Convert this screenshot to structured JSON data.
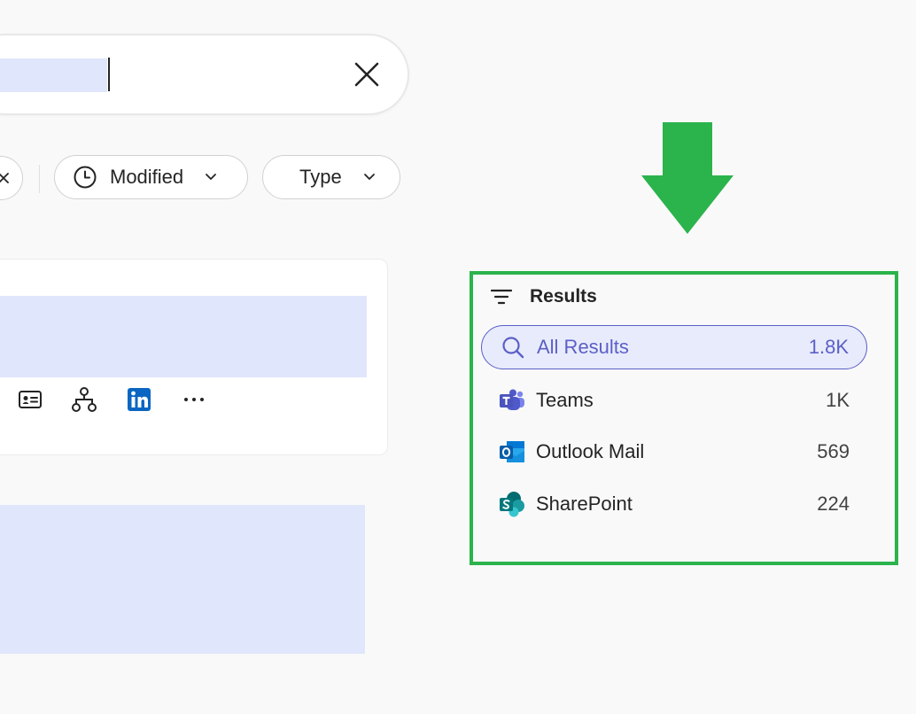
{
  "filters": {
    "modified_label": "Modified",
    "type_label": "Type"
  },
  "results": {
    "title": "Results",
    "items": [
      {
        "name": "All Results",
        "count": "1.8K",
        "icon": "search-icon",
        "active": true
      },
      {
        "name": "Teams",
        "count": "1K",
        "icon": "teams-icon"
      },
      {
        "name": "Outlook Mail",
        "count": "569",
        "icon": "outlook-icon"
      },
      {
        "name": "SharePoint",
        "count": "224",
        "icon": "sharepoint-icon"
      }
    ]
  },
  "colors": {
    "accent": "#5b5fc7",
    "highlight": "#e0e6fb",
    "annotation_green": "#2bb34c",
    "linkedin_blue": "#0a66c2"
  }
}
